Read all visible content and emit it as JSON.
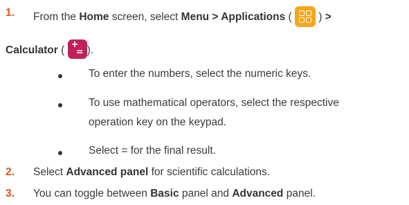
{
  "steps": [
    {
      "number": "1.",
      "line1": {
        "t1": "From the ",
        "b1": "Home",
        "t2": " screen, select ",
        "b2": "Menu > Applications",
        "t3": " (",
        "t4": ") ",
        "b3": ">"
      },
      "line2": {
        "b1": "Calculator",
        "t1": " (",
        "t2": ")."
      },
      "bullets": [
        "To enter the numbers, select the numeric keys.",
        "To use mathematical operators, select the respective",
        "operation key on the keypad.",
        "Select = for the final result."
      ]
    },
    {
      "number": "2.",
      "t1": "Select ",
      "b1": "Advanced panel",
      "t2": " for scientific calculations."
    },
    {
      "number": "3.",
      "t1": "You can toggle between ",
      "b1": "Basic",
      "t2": " panel and ",
      "b2": "Advanced",
      "t3": " panel."
    }
  ],
  "icons": {
    "applications": "applications-grid-icon",
    "calculator": "calculator-icon",
    "applications_color": "#f7a51b",
    "calculator_color": "#c0215a"
  },
  "calculator_icon_glyphs": {
    "plus": "+",
    "equals": "="
  },
  "colors": {
    "step_number": "#e0531b",
    "text": "#3a3a3a"
  }
}
